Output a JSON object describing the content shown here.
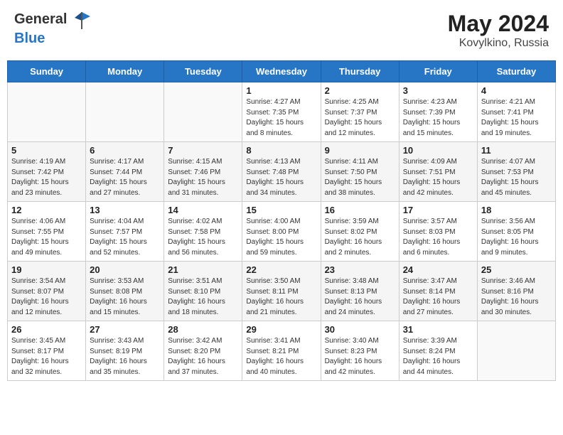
{
  "header": {
    "logo_line1": "General",
    "logo_line2": "Blue",
    "title": "May 2024",
    "location": "Kovylkino, Russia"
  },
  "weekdays": [
    "Sunday",
    "Monday",
    "Tuesday",
    "Wednesday",
    "Thursday",
    "Friday",
    "Saturday"
  ],
  "weeks": [
    [
      {
        "day": "",
        "info": ""
      },
      {
        "day": "",
        "info": ""
      },
      {
        "day": "",
        "info": ""
      },
      {
        "day": "1",
        "info": "Sunrise: 4:27 AM\nSunset: 7:35 PM\nDaylight: 15 hours\nand 8 minutes."
      },
      {
        "day": "2",
        "info": "Sunrise: 4:25 AM\nSunset: 7:37 PM\nDaylight: 15 hours\nand 12 minutes."
      },
      {
        "day": "3",
        "info": "Sunrise: 4:23 AM\nSunset: 7:39 PM\nDaylight: 15 hours\nand 15 minutes."
      },
      {
        "day": "4",
        "info": "Sunrise: 4:21 AM\nSunset: 7:41 PM\nDaylight: 15 hours\nand 19 minutes."
      }
    ],
    [
      {
        "day": "5",
        "info": "Sunrise: 4:19 AM\nSunset: 7:42 PM\nDaylight: 15 hours\nand 23 minutes."
      },
      {
        "day": "6",
        "info": "Sunrise: 4:17 AM\nSunset: 7:44 PM\nDaylight: 15 hours\nand 27 minutes."
      },
      {
        "day": "7",
        "info": "Sunrise: 4:15 AM\nSunset: 7:46 PM\nDaylight: 15 hours\nand 31 minutes."
      },
      {
        "day": "8",
        "info": "Sunrise: 4:13 AM\nSunset: 7:48 PM\nDaylight: 15 hours\nand 34 minutes."
      },
      {
        "day": "9",
        "info": "Sunrise: 4:11 AM\nSunset: 7:50 PM\nDaylight: 15 hours\nand 38 minutes."
      },
      {
        "day": "10",
        "info": "Sunrise: 4:09 AM\nSunset: 7:51 PM\nDaylight: 15 hours\nand 42 minutes."
      },
      {
        "day": "11",
        "info": "Sunrise: 4:07 AM\nSunset: 7:53 PM\nDaylight: 15 hours\nand 45 minutes."
      }
    ],
    [
      {
        "day": "12",
        "info": "Sunrise: 4:06 AM\nSunset: 7:55 PM\nDaylight: 15 hours\nand 49 minutes."
      },
      {
        "day": "13",
        "info": "Sunrise: 4:04 AM\nSunset: 7:57 PM\nDaylight: 15 hours\nand 52 minutes."
      },
      {
        "day": "14",
        "info": "Sunrise: 4:02 AM\nSunset: 7:58 PM\nDaylight: 15 hours\nand 56 minutes."
      },
      {
        "day": "15",
        "info": "Sunrise: 4:00 AM\nSunset: 8:00 PM\nDaylight: 15 hours\nand 59 minutes."
      },
      {
        "day": "16",
        "info": "Sunrise: 3:59 AM\nSunset: 8:02 PM\nDaylight: 16 hours\nand 2 minutes."
      },
      {
        "day": "17",
        "info": "Sunrise: 3:57 AM\nSunset: 8:03 PM\nDaylight: 16 hours\nand 6 minutes."
      },
      {
        "day": "18",
        "info": "Sunrise: 3:56 AM\nSunset: 8:05 PM\nDaylight: 16 hours\nand 9 minutes."
      }
    ],
    [
      {
        "day": "19",
        "info": "Sunrise: 3:54 AM\nSunset: 8:07 PM\nDaylight: 16 hours\nand 12 minutes."
      },
      {
        "day": "20",
        "info": "Sunrise: 3:53 AM\nSunset: 8:08 PM\nDaylight: 16 hours\nand 15 minutes."
      },
      {
        "day": "21",
        "info": "Sunrise: 3:51 AM\nSunset: 8:10 PM\nDaylight: 16 hours\nand 18 minutes."
      },
      {
        "day": "22",
        "info": "Sunrise: 3:50 AM\nSunset: 8:11 PM\nDaylight: 16 hours\nand 21 minutes."
      },
      {
        "day": "23",
        "info": "Sunrise: 3:48 AM\nSunset: 8:13 PM\nDaylight: 16 hours\nand 24 minutes."
      },
      {
        "day": "24",
        "info": "Sunrise: 3:47 AM\nSunset: 8:14 PM\nDaylight: 16 hours\nand 27 minutes."
      },
      {
        "day": "25",
        "info": "Sunrise: 3:46 AM\nSunset: 8:16 PM\nDaylight: 16 hours\nand 30 minutes."
      }
    ],
    [
      {
        "day": "26",
        "info": "Sunrise: 3:45 AM\nSunset: 8:17 PM\nDaylight: 16 hours\nand 32 minutes."
      },
      {
        "day": "27",
        "info": "Sunrise: 3:43 AM\nSunset: 8:19 PM\nDaylight: 16 hours\nand 35 minutes."
      },
      {
        "day": "28",
        "info": "Sunrise: 3:42 AM\nSunset: 8:20 PM\nDaylight: 16 hours\nand 37 minutes."
      },
      {
        "day": "29",
        "info": "Sunrise: 3:41 AM\nSunset: 8:21 PM\nDaylight: 16 hours\nand 40 minutes."
      },
      {
        "day": "30",
        "info": "Sunrise: 3:40 AM\nSunset: 8:23 PM\nDaylight: 16 hours\nand 42 minutes."
      },
      {
        "day": "31",
        "info": "Sunrise: 3:39 AM\nSunset: 8:24 PM\nDaylight: 16 hours\nand 44 minutes."
      },
      {
        "day": "",
        "info": ""
      }
    ]
  ]
}
